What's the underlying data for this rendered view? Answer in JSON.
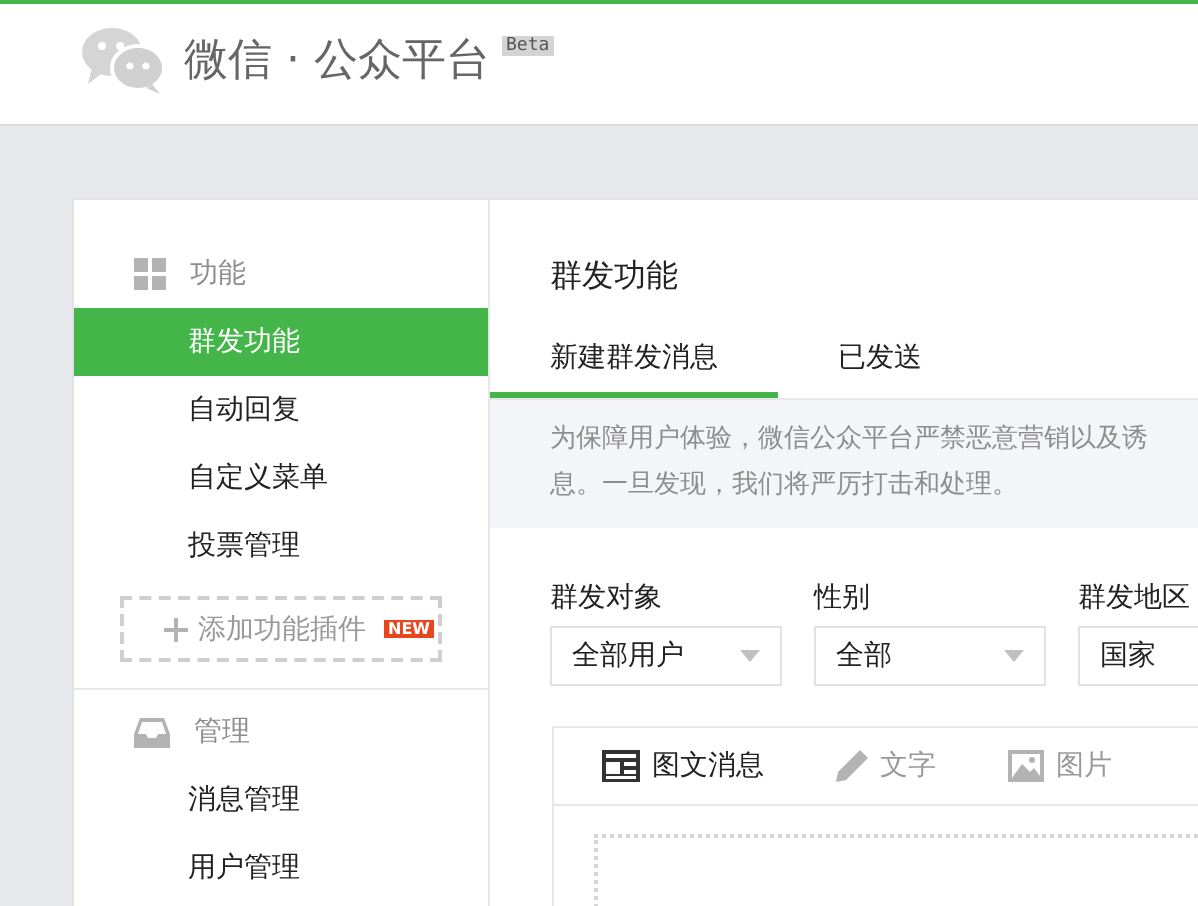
{
  "header": {
    "logo_text": "微信 · 公众平台",
    "badge": "Beta"
  },
  "sidebar": {
    "sections": [
      {
        "title": "功能",
        "items": [
          {
            "label": "群发功能",
            "selected": true
          },
          {
            "label": "自动回复",
            "selected": false
          },
          {
            "label": "自定义菜单",
            "selected": false
          },
          {
            "label": "投票管理",
            "selected": false
          }
        ],
        "add_button": {
          "label": "添加功能插件",
          "badge": "NEW"
        }
      },
      {
        "title": "管理",
        "items": [
          {
            "label": "消息管理",
            "selected": false
          },
          {
            "label": "用户管理",
            "selected": false
          }
        ]
      }
    ]
  },
  "main": {
    "title": "群发功能",
    "tabs": [
      {
        "label": "新建群发消息",
        "selected": true
      },
      {
        "label": "已发送",
        "selected": false
      }
    ],
    "notice_lines": [
      "为保障用户体验，微信公众平台严禁恶意营销以及诱",
      "息。一旦发现，我们将严厉打击和处理。"
    ],
    "filters": [
      {
        "label": "群发对象",
        "value": "全部用户",
        "dropdown": true
      },
      {
        "label": "性别",
        "value": "全部",
        "dropdown": true
      },
      {
        "label": "群发地区",
        "value": "国家",
        "dropdown": false
      }
    ],
    "editor_tabs": [
      {
        "label": "图文消息",
        "selected": true
      },
      {
        "label": "文字",
        "selected": false
      },
      {
        "label": "图片",
        "selected": false
      }
    ]
  }
}
